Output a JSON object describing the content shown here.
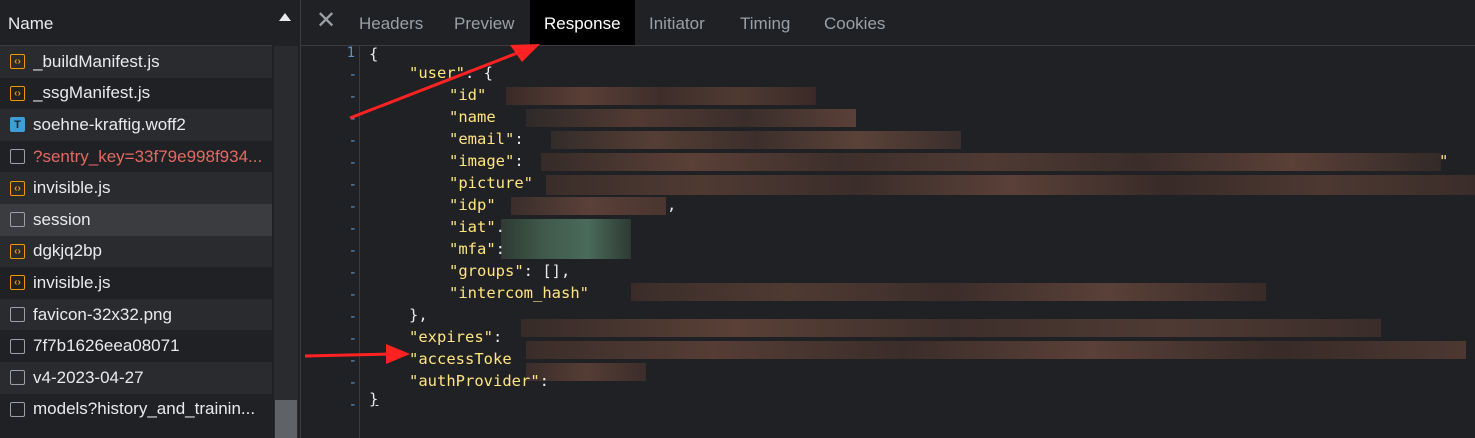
{
  "left_panel": {
    "header": "Name",
    "files": [
      {
        "name": "_buildManifest.js",
        "icon": "script-icon",
        "type": "script"
      },
      {
        "name": "_ssgManifest.js",
        "icon": "script-icon",
        "type": "script"
      },
      {
        "name": "soehne-kraftig.woff2",
        "icon": "font-icon",
        "type": "font"
      },
      {
        "name": "?sentry_key=33f79e998f934...",
        "icon": "document-icon",
        "type": "error"
      },
      {
        "name": "invisible.js",
        "icon": "script-icon",
        "type": "script"
      },
      {
        "name": "session",
        "icon": "document-icon",
        "type": "selected"
      },
      {
        "name": "dgkjq2bp",
        "icon": "script-icon",
        "type": "script"
      },
      {
        "name": "invisible.js",
        "icon": "script-icon",
        "type": "script"
      },
      {
        "name": "favicon-32x32.png",
        "icon": "document-icon",
        "type": "doc"
      },
      {
        "name": "7f7b1626eea08071",
        "icon": "document-icon",
        "type": "doc"
      },
      {
        "name": "v4-2023-04-27",
        "icon": "document-icon",
        "type": "doc"
      },
      {
        "name": "models?history_and_trainin...",
        "icon": "document-icon",
        "type": "doc"
      }
    ]
  },
  "tabs": {
    "close_icon": "close-icon",
    "headers": "Headers",
    "preview": "Preview",
    "response": "Response",
    "initiator": "Initiator",
    "timing": "Timing",
    "cookies": "Cookies",
    "active": "Response"
  },
  "code": {
    "line_number": "1",
    "fold_marker": "-",
    "open_brace": "{",
    "close_brace": "}",
    "user_key": "\"user\"",
    "user_tail": ": {",
    "id_key": "\"id\"",
    "name_key": "\"name",
    "email_key": "\"email\"",
    "email_tail": ":",
    "image_key": "\"image\"",
    "image_tail": ":",
    "picture_key": "\"picture\"",
    "idp_key": "\"idp\"",
    "idp_tail": ",",
    "iat_key": "\"iat\"",
    "iat_tail": ".",
    "mfa_key": "\"mfa\"",
    "mfa_tail": ":",
    "groups_key": "\"groups\"",
    "groups_tail": ": [],",
    "intercom_key": "\"intercom_hash\"",
    "user_close": "},",
    "expires_key": "\"expires\"",
    "expires_tail": ":",
    "access_key": "\"accessToke",
    "auth_key": "\"authProvider\"",
    "auth_tail": ":",
    "trailing_quote": "\""
  },
  "colors": {
    "key": "#ffe57f",
    "annotation_arrow": "#ff2222",
    "line_number": "#5e90c8"
  }
}
